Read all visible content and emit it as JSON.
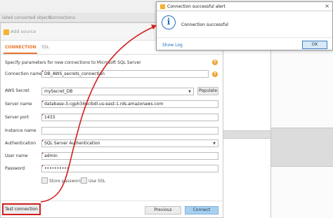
{
  "background": {
    "tabs": [
      "lated converted objects",
      "Connections"
    ]
  },
  "dialog": {
    "title": "Add source",
    "tabs": [
      {
        "label": "CONNECTION",
        "active": true
      },
      {
        "label": "SSL",
        "active": false
      }
    ],
    "instruction": "Specify parameters for new connections to Microsoft SQL Server",
    "fields": {
      "connection_name": {
        "label": "Connection name",
        "value": "DB_AWS_secrets_connection"
      },
      "aws_secret": {
        "label": "AWS Secret",
        "value": "mySecret_DB",
        "button": "Populate"
      },
      "server_name": {
        "label": "Server name",
        "value": "database-3.cgph34pcibdl.us-east-1.rds.amazonaws.com"
      },
      "server_port": {
        "label": "Server port",
        "value": "1433"
      },
      "instance_name": {
        "label": "Instance name",
        "value": ""
      },
      "authentication": {
        "label": "Authentication",
        "value": "SQL Server Authentication"
      },
      "user_name": {
        "label": "User name",
        "value": "admin"
      },
      "password": {
        "label": "Password",
        "value": "••••••••••"
      }
    },
    "store_password_label": "Store password",
    "use_ssl_label": "Use SSL",
    "buttons": {
      "test_connection": "Test connection",
      "previous": "Previous",
      "connect": "Connect"
    }
  },
  "alert": {
    "title": "Connection successful alert",
    "message": "Connection successful",
    "show_log": "Show Log",
    "ok": "OK",
    "close_glyph": "×",
    "info_glyph": "i"
  },
  "icons": {
    "help_glyph": "?",
    "dropdown_glyph": "▼"
  },
  "colors": {
    "accent_orange": "#e8752b",
    "annotation_red": "#d21f1f",
    "info_blue": "#1f6fc2"
  }
}
